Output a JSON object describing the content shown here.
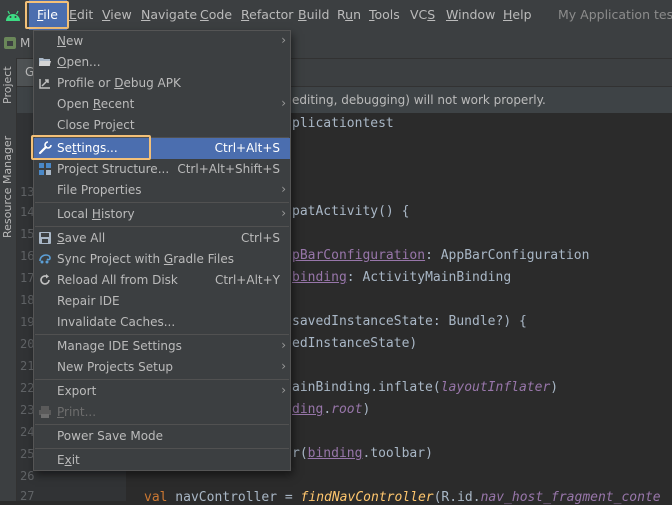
{
  "menubar": {
    "items": [
      {
        "pre": "",
        "mn": "F",
        "post": "ile"
      },
      {
        "pre": "",
        "mn": "E",
        "post": "dit"
      },
      {
        "pre": "",
        "mn": "V",
        "post": "iew"
      },
      {
        "pre": "",
        "mn": "N",
        "post": "avigate"
      },
      {
        "pre": "",
        "mn": "C",
        "post": "ode"
      },
      {
        "pre": "",
        "mn": "R",
        "post": "efactor"
      },
      {
        "pre": "",
        "mn": "B",
        "post": "uild"
      },
      {
        "pre": "R",
        "mn": "u",
        "post": "n"
      },
      {
        "pre": "",
        "mn": "T",
        "post": "ools"
      },
      {
        "pre": "VC",
        "mn": "S",
        "post": ""
      },
      {
        "pre": "",
        "mn": "W",
        "post": "indow"
      },
      {
        "pre": "",
        "mn": "H",
        "post": "elp"
      }
    ],
    "window_title": "My Application test -"
  },
  "toolbar": {
    "project_frag": "M"
  },
  "side_tabs": {
    "project": "Project",
    "resource_manager": "Resource Manager"
  },
  "editor_tab_frag": "G",
  "banner": {
    "text": "editing, debugging) will not work properly."
  },
  "gutter": {
    "line_numbers": [
      "13",
      "14",
      "15",
      "16",
      "17",
      "18",
      "19",
      "20",
      "21",
      "22",
      "23",
      "24",
      "25",
      "26",
      "27"
    ]
  },
  "code": {
    "l1": "plicationtest",
    "l2_text": "patActivity() {",
    "l3_purple": "pBarConfiguration",
    "l3_rest": ": AppBarConfiguration",
    "l4_purple": "binding",
    "l4_rest": ": ActivityMainBinding",
    "l5": "savedInstanceState: Bundle?) {",
    "l6": "edInstanceState)",
    "l7_a": "ainBinding.inflate(",
    "l7_b": "layoutInflater",
    "l7_c": ")",
    "l8_a": "ding",
    "l8_b": ".",
    "l8_c": "root",
    "l8_d": ")",
    "l9_a": "r(",
    "l9_b": "binding",
    "l9_c": ".toolbar)",
    "l10_kw": "val",
    "l10_a": " navController = ",
    "l10_fn": "findNavController",
    "l10_b": "(R.id.",
    "l10_c": "nav_host_fragment_conte"
  },
  "file_menu": {
    "items": [
      {
        "pre": "",
        "mn": "N",
        "post": "ew",
        "shortcut": "",
        "submenu": true
      },
      {
        "pre": "",
        "mn": "O",
        "post": "pen...",
        "shortcut": "",
        "submenu": false
      },
      {
        "pre": "Profile or ",
        "mn": "D",
        "post": "ebug APK",
        "shortcut": "",
        "submenu": false
      },
      {
        "pre": "Open ",
        "mn": "R",
        "post": "ecent",
        "shortcut": "",
        "submenu": true
      },
      {
        "pre": "Close Pro",
        "mn": "j",
        "post": "ect",
        "shortcut": "",
        "submenu": false
      },
      {
        "pre": "Se",
        "mn": "t",
        "post": "tings...",
        "shortcut": "Ctrl+Alt+S",
        "submenu": false
      },
      {
        "pre": "Project Structure...",
        "mn": "",
        "post": "",
        "shortcut": "Ctrl+Alt+Shift+S",
        "submenu": false
      },
      {
        "pre": "File Properties",
        "mn": "",
        "post": "",
        "shortcut": "",
        "submenu": true
      },
      {
        "pre": "Local ",
        "mn": "H",
        "post": "istory",
        "shortcut": "",
        "submenu": true
      },
      {
        "pre": "",
        "mn": "S",
        "post": "ave All",
        "shortcut": "Ctrl+S",
        "submenu": false
      },
      {
        "pre": "Sync Project with ",
        "mn": "G",
        "post": "radle Files",
        "shortcut": "",
        "submenu": false
      },
      {
        "pre": "Reload All from Disk",
        "mn": "",
        "post": "",
        "shortcut": "Ctrl+Alt+Y",
        "submenu": false
      },
      {
        "pre": "Repair IDE",
        "mn": "",
        "post": "",
        "shortcut": "",
        "submenu": false
      },
      {
        "pre": "Invalidate Caches...",
        "mn": "",
        "post": "",
        "shortcut": "",
        "submenu": false
      },
      {
        "pre": "Manage IDE Settings",
        "mn": "",
        "post": "",
        "shortcut": "",
        "submenu": true
      },
      {
        "pre": "New Projects Setup",
        "mn": "",
        "post": "",
        "shortcut": "",
        "submenu": true
      },
      {
        "pre": "Export",
        "mn": "",
        "post": "",
        "shortcut": "",
        "submenu": true
      },
      {
        "pre": "",
        "mn": "P",
        "post": "rint...",
        "shortcut": "",
        "submenu": false
      },
      {
        "pre": "Power Save Mode",
        "mn": "",
        "post": "",
        "shortcut": "",
        "submenu": false
      },
      {
        "pre": "E",
        "mn": "x",
        "post": "it",
        "shortcut": "",
        "submenu": false
      }
    ]
  }
}
